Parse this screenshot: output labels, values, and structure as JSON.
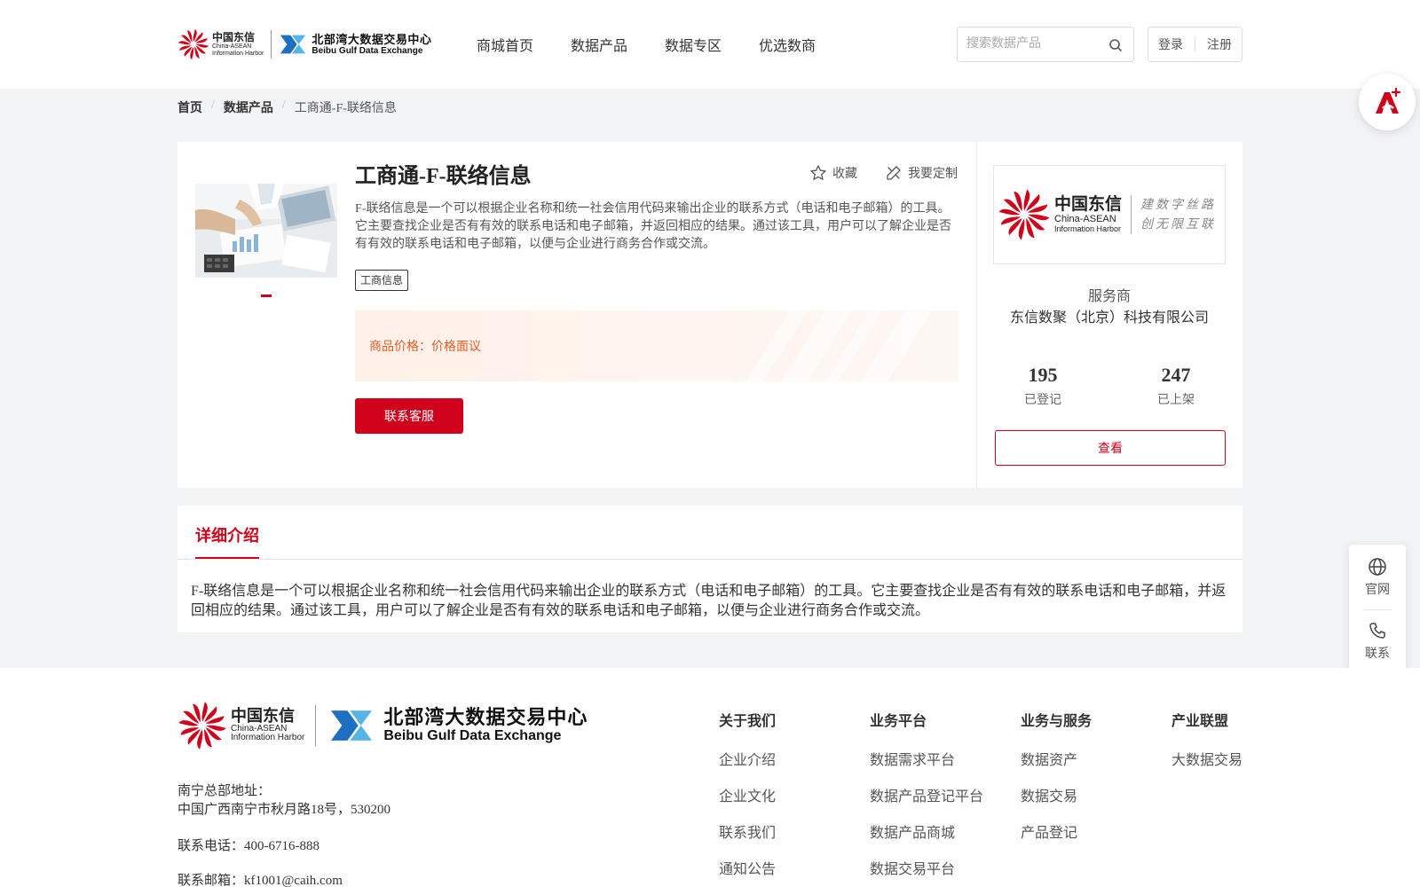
{
  "header": {
    "logo_ca_cn": "中国东信",
    "logo_ca_en1": "China-ASEAN",
    "logo_ca_en2": "Information Harbor",
    "logo_bg_cn": "北部湾大数据交易中心",
    "logo_bg_en": "Beibu Gulf Data Exchange",
    "nav": [
      "商城首页",
      "数据产品",
      "数据专区",
      "优选数商"
    ],
    "search_placeholder": "搜索数据产品",
    "login": "登录",
    "register": "注册"
  },
  "breadcrumb": {
    "home": "首页",
    "category": "数据产品",
    "current": "工商通-F-联络信息"
  },
  "product": {
    "title": "工商通-F-联络信息",
    "favorite": "收藏",
    "customize": "我要定制",
    "description": "F-联络信息是一个可以根据企业名称和统一社会信用代码来输出企业的联系方式（电话和电子邮箱）的工具。它主要查找企业是否有有效的联系电话和电子邮箱，并返回相应的结果。通过该工具，用户可以了解企业是否有有效的联系电话和电子邮箱，以便与企业进行商务合作或交流。",
    "tag": "工商信息",
    "price_label": "商品价格：",
    "price_value": "价格面议",
    "contact_button": "联系客服"
  },
  "provider": {
    "logo_cn": "中国东信",
    "logo_en1": "China-ASEAN",
    "logo_en2": "Information Harbor",
    "slogan_1": "建数字丝路",
    "slogan_2": "创无限互联",
    "label": "服务商",
    "name": "东信数聚（北京）科技有限公司",
    "registered_count": "195",
    "registered_label": "已登记",
    "listed_count": "247",
    "listed_label": "已上架",
    "view_button": "查看"
  },
  "detail": {
    "tab": "详细介绍",
    "text": "F-联络信息是一个可以根据企业名称和统一社会信用代码来输出企业的联系方式（电话和电子邮箱）的工具。它主要查找企业是否有有效的联系电话和电子邮箱，并返回相应的结果。通过该工具，用户可以了解企业是否有有效的联系电话和电子邮箱，以便与企业进行商务合作或交流。"
  },
  "float": {
    "website": "官网",
    "contact": "联系"
  },
  "footer": {
    "logo_ca_cn": "中国东信",
    "logo_ca_en1": "China-ASEAN",
    "logo_ca_en2": "Information Harbor",
    "logo_bg_cn": "北部湾大数据交易中心",
    "logo_bg_en": "Beibu Gulf Data Exchange",
    "address_label": "南宁总部地址：",
    "address": "中国广西南宁市秋月路18号，530200",
    "phone": "联系电话：400-6716-888",
    "email": "联系邮箱：kf1001@caih.com",
    "columns": [
      {
        "head": "关于我们",
        "links": [
          "企业介绍",
          "企业文化",
          "联系我们",
          "通知公告"
        ]
      },
      {
        "head": "业务平台",
        "links": [
          "数据需求平台",
          "数据产品登记平台",
          "数据产品商城",
          "数据交易平台"
        ]
      },
      {
        "head": "业务与服务",
        "links": [
          "数据资产",
          "数据交易",
          "产品登记"
        ]
      },
      {
        "head": "产业联盟",
        "links": [
          "大数据交易"
        ]
      }
    ]
  },
  "colors": {
    "brand_red": "#d0021b",
    "price_orange": "#e85d23",
    "band_grey": "#f2f3f5",
    "logo_blue": "#2f8bd6"
  }
}
